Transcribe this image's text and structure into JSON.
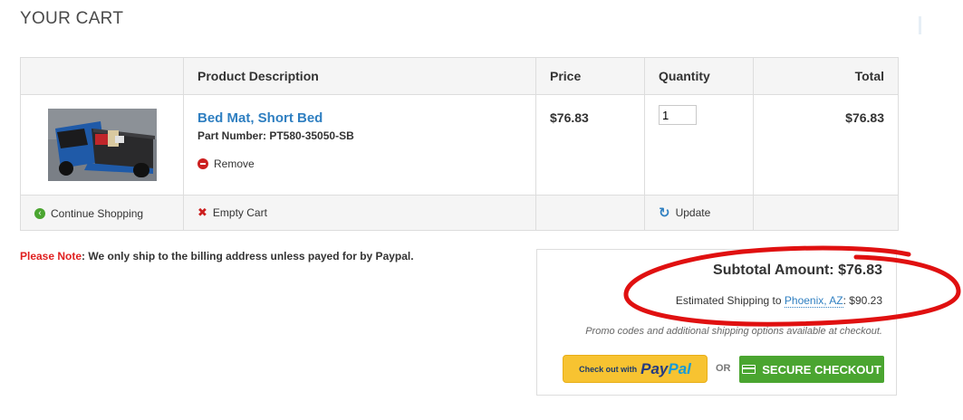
{
  "page": {
    "title": "YOUR CART"
  },
  "table": {
    "headers": {
      "description": "Product Description",
      "price": "Price",
      "quantity": "Quantity",
      "total": "Total"
    },
    "items": [
      {
        "name": "Bed Mat, Short Bed",
        "part_number": "Part Number: PT580-35050-SB",
        "remove_label": "Remove",
        "price": "$76.83",
        "quantity": "1",
        "total": "$76.83",
        "image_icon": "truck-bed-mat-photo"
      }
    ],
    "actions": {
      "continue_shopping": "Continue Shopping",
      "empty_cart": "Empty Cart",
      "update": "Update"
    }
  },
  "note": {
    "label": "Please Note",
    "text": "We only ship to the billing address unless payed for by Paypal."
  },
  "summary": {
    "subtotal": "Subtotal Amount: $76.83",
    "shipping_prefix": "Estimated Shipping to ",
    "shipping_location": "Phoenix, AZ",
    "shipping_amount": ": $90.23",
    "promo": "Promo codes and additional shipping options available at checkout.",
    "paypal_prefix": "Check out with",
    "paypal_pay": "Pay",
    "paypal_pal": "Pal",
    "or": "OR",
    "secure_checkout": "SECURE CHECKOUT"
  },
  "colors": {
    "link": "#2f7fc1",
    "accent_green": "#4aa530",
    "paypal_yellow": "#f7c331",
    "note_red": "#e02020",
    "annotation_red": "#e01010"
  }
}
